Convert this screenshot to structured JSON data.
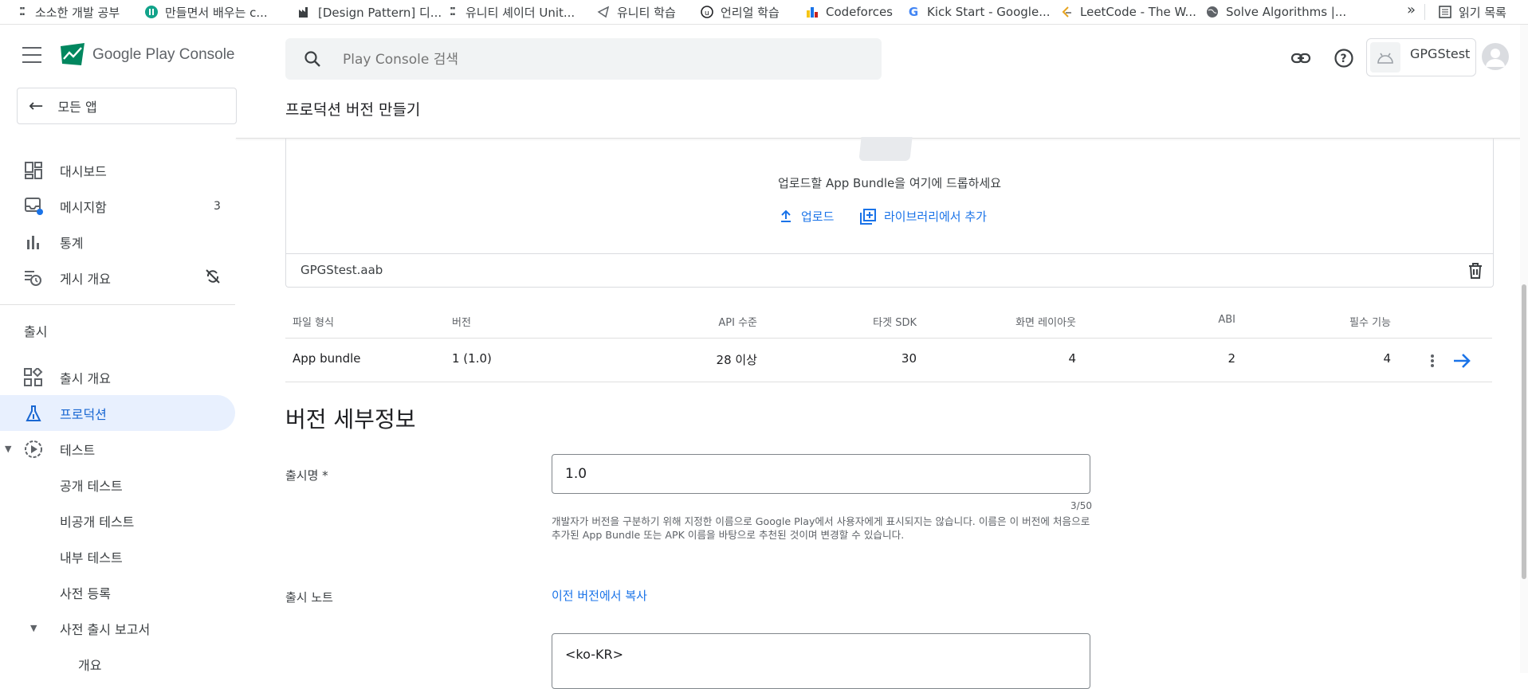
{
  "bookmarks": [
    {
      "label": "소소한 개발 공부",
      "icon": "dots-icon"
    },
    {
      "label": "만들면서 배우는 c...",
      "icon": "circle-logo-icon"
    },
    {
      "label": "[Design Pattern] 디...",
      "icon": "factory-icon"
    },
    {
      "label": "유니티 셰이더 Unit...",
      "icon": "dots-icon"
    },
    {
      "label": "유니티 학습",
      "icon": "unity-icon"
    },
    {
      "label": "언리얼 학습",
      "icon": "unreal-icon"
    },
    {
      "label": "Codeforces",
      "icon": "codeforces-icon"
    },
    {
      "label": "Kick Start - Google...",
      "icon": "google-icon"
    },
    {
      "label": "LeetCode - The W...",
      "icon": "leetcode-icon"
    },
    {
      "label": "Solve Algorithms |...",
      "icon": "globe-icon"
    }
  ],
  "bookmarks_more": "»",
  "reading_list": "읽기 목록",
  "app": {
    "title": "Google Play Console"
  },
  "sidebar": {
    "all_apps": "모든 앱",
    "items": [
      {
        "label": "대시보드",
        "icon": "dashboard-icon"
      },
      {
        "label": "메시지함",
        "icon": "inbox-icon",
        "count": "3"
      },
      {
        "label": "통계",
        "icon": "bar-chart-icon"
      },
      {
        "label": "게시 개요",
        "icon": "publishing-icon"
      }
    ],
    "release_section": "출시",
    "release_items": [
      {
        "label": "출시 개요",
        "icon": "release-overview-icon"
      },
      {
        "label": "프로덕션",
        "icon": "production-icon",
        "active": true
      },
      {
        "label": "테스트",
        "icon": "testing-icon"
      },
      {
        "label": "공개 테스트"
      },
      {
        "label": "비공개 테스트"
      },
      {
        "label": "내부 테스트"
      },
      {
        "label": "사전 등록"
      },
      {
        "label": "사전 출시 보고서"
      },
      {
        "label": "개요"
      }
    ]
  },
  "search": {
    "placeholder": "Play Console 검색"
  },
  "developer": {
    "name": "GPGStest"
  },
  "page": {
    "title": "프로덕션 버전 만들기"
  },
  "upload": {
    "drop_text": "업로드할 App Bundle을 여기에 드롭하세요",
    "upload_label": "업로드",
    "library_label": "라이브러리에서 추가",
    "file_name": "GPGStest.aab"
  },
  "bundle_table": {
    "headers": [
      "파일 형식",
      "버전",
      "API 수준",
      "타겟 SDK",
      "화면 레이아웃",
      "ABI",
      "필수 기능"
    ],
    "row": [
      "App bundle",
      "1 (1.0)",
      "28 이상",
      "30",
      "4",
      "2",
      "4"
    ]
  },
  "details": {
    "title": "버전 세부정보",
    "release_name_label": "출시명 *",
    "release_name_value": "1.0",
    "counter": "3/50",
    "help_text": "개발자가 버전을 구분하기 위해 지정한 이름으로 Google Play에서 사용자에게 표시되지는 않습니다. 이름은 이 버전에 처음으로 추가된 App Bundle 또는 APK 이름을 바탕으로 추천된 것이며 변경할 수 있습니다.",
    "release_notes_label": "출시 노트",
    "copy_link": "이전 버전에서 복사",
    "notes_value": "<ko-KR>"
  },
  "colors": {
    "accent": "#1a73e8",
    "active_bg": "#e8f0fe"
  }
}
